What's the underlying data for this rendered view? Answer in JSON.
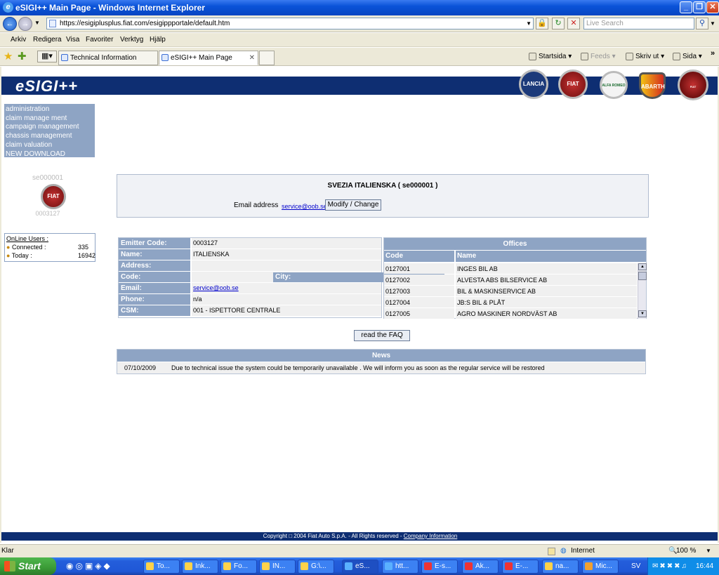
{
  "window": {
    "title": "eSIGI++ Main Page - Windows Internet Explorer"
  },
  "browser": {
    "url": "https://esigiplusplus.fiat.com/esigippportale/default.htm",
    "search_placeholder": "Live Search",
    "menu": [
      "Arkiv",
      "Redigera",
      "Visa",
      "Favoriter",
      "Verktyg",
      "Hjälp"
    ],
    "tabs": [
      {
        "label": "Technical Information"
      },
      {
        "label": "eSIGI++ Main Page"
      }
    ],
    "commands": {
      "home": "Startsida",
      "feeds": "Feeds",
      "print": "Skriv ut",
      "page": "Sida"
    },
    "status_left": "Klar",
    "zone": "Internet",
    "zoom": "100 %"
  },
  "page": {
    "logo": "eSIGI++",
    "brands": [
      "LANCIA",
      "FIAT",
      "ALFA ROMEO",
      "ABARTH",
      "FIAT PROFESSIONAL"
    ],
    "left_menu": [
      "administration",
      "claim manage ment",
      "campaign management",
      "chassis management",
      "claim valuation",
      "NEW DOWNLOAD UPLOAD"
    ],
    "dealer_id": "se000001",
    "emitter_code_small": "0003127",
    "badge_text": "FIAT",
    "online": {
      "title": "OnLine Users :",
      "connected_label": "Connected :",
      "connected_value": "335",
      "today_label": "Today :",
      "today_value": "16942"
    },
    "dealer": {
      "title": "SVEZIA ITALIENSKA ( se000001 )",
      "email_label": "Email address",
      "email": "service@oob.se",
      "modify_button": "Modify / Change"
    },
    "emitter": {
      "rows": [
        {
          "key": "Emitter Code:",
          "value": "0003127"
        },
        {
          "key": "Name:",
          "value": "ITALIENSKA"
        },
        {
          "key": "Address:",
          "value": ""
        },
        {
          "key": "Code:",
          "value": ""
        },
        {
          "key": "Email:",
          "value": "service@oob.se"
        },
        {
          "key": "Phone:",
          "value": "n/a"
        },
        {
          "key": "CSM:",
          "value": "001 - ISPETTORE CENTRALE"
        }
      ],
      "city_label": "City:"
    },
    "offices": {
      "title": "Offices",
      "col_code": "Code",
      "col_name": "Name",
      "rows": [
        {
          "code": "0127001",
          "name": "INGES BIL AB"
        },
        {
          "code": "0127002",
          "name": "ALVESTA ABS BILSERVICE AB"
        },
        {
          "code": "0127003",
          "name": "BIL & MASKINSERVICE AB"
        },
        {
          "code": "0127004",
          "name": "JB:S BIL & PLÅT"
        },
        {
          "code": "0127005",
          "name": "AGRO MASKINER NORDVÄST AB"
        }
      ]
    },
    "faq_button": "read the FAQ",
    "news": {
      "title": "News",
      "date": "07/10/2009",
      "text": "Due to technical issue the system could be temporarily unavailable . We will inform you as soon as the regular service will be restored"
    },
    "footer": {
      "copyright": "Copyright □ 2004 Fiat Auto S.p.A. - All Rights reserved -",
      "link": "Company Information"
    }
  },
  "taskbar": {
    "start": "Start",
    "tasks": [
      "To...",
      "Ink...",
      "Fo...",
      "IN...",
      "G:\\...",
      "eS...",
      "htt...",
      "E-s...",
      "Ak...",
      "E-...",
      "na...",
      "Mic..."
    ],
    "lang": "SV",
    "clock": "16:44"
  }
}
